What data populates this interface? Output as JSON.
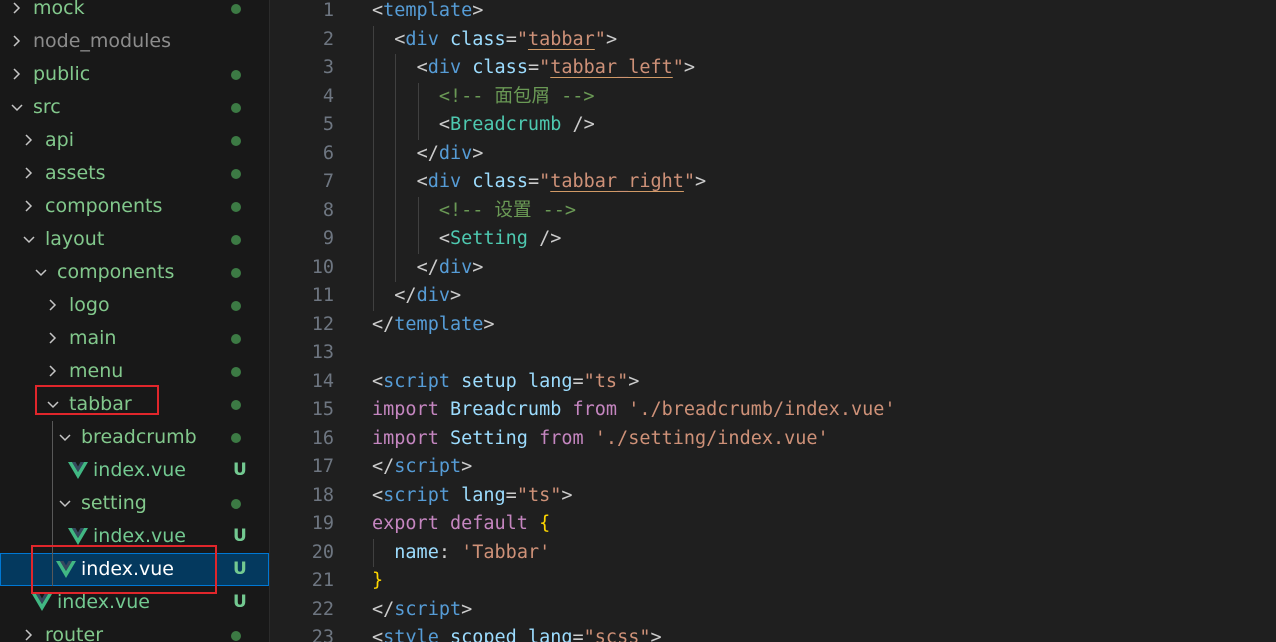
{
  "explorer": {
    "items": [
      {
        "label": "mock",
        "indent": 0,
        "kind": "folder",
        "state": "collapsed",
        "color": "#82c88c",
        "status": "dot"
      },
      {
        "label": "node_modules",
        "indent": 0,
        "kind": "folder",
        "state": "collapsed",
        "color": "#8c8c8c",
        "status": "none"
      },
      {
        "label": "public",
        "indent": 0,
        "kind": "folder",
        "state": "collapsed",
        "color": "#82c88c",
        "status": "dot"
      },
      {
        "label": "src",
        "indent": 0,
        "kind": "folder",
        "state": "expanded",
        "color": "#82c88c",
        "status": "dot"
      },
      {
        "label": "api",
        "indent": 1,
        "kind": "folder",
        "state": "collapsed",
        "color": "#82c88c",
        "status": "dot"
      },
      {
        "label": "assets",
        "indent": 1,
        "kind": "folder",
        "state": "collapsed",
        "color": "#82c88c",
        "status": "dot"
      },
      {
        "label": "components",
        "indent": 1,
        "kind": "folder",
        "state": "collapsed",
        "color": "#82c88c",
        "status": "dot"
      },
      {
        "label": "layout",
        "indent": 1,
        "kind": "folder",
        "state": "expanded",
        "color": "#82c88c",
        "status": "dot"
      },
      {
        "label": "components",
        "indent": 2,
        "kind": "folder",
        "state": "expanded",
        "color": "#82c88c",
        "status": "dot"
      },
      {
        "label": "logo",
        "indent": 3,
        "kind": "folder",
        "state": "collapsed",
        "color": "#82c88c",
        "status": "dot"
      },
      {
        "label": "main",
        "indent": 3,
        "kind": "folder",
        "state": "collapsed",
        "color": "#82c88c",
        "status": "dot"
      },
      {
        "label": "menu",
        "indent": 3,
        "kind": "folder",
        "state": "collapsed",
        "color": "#82c88c",
        "status": "dot"
      },
      {
        "label": "tabbar",
        "indent": 3,
        "kind": "folder",
        "state": "expanded",
        "color": "#82c88c",
        "status": "dot"
      },
      {
        "label": "breadcrumb",
        "indent": 4,
        "kind": "folder",
        "state": "expanded",
        "color": "#82c88c",
        "status": "dot"
      },
      {
        "label": "index.vue",
        "indent": 5,
        "kind": "vue",
        "color": "#73c991",
        "status": "U"
      },
      {
        "label": "setting",
        "indent": 4,
        "kind": "folder",
        "state": "expanded",
        "color": "#82c88c",
        "status": "dot"
      },
      {
        "label": "index.vue",
        "indent": 5,
        "kind": "vue",
        "color": "#73c991",
        "status": "U"
      },
      {
        "label": "index.vue",
        "indent": 4,
        "kind": "vue",
        "color": "#ffffff",
        "status": "U",
        "selected": true
      },
      {
        "label": "index.vue",
        "indent": 2,
        "kind": "vue",
        "color": "#73c991",
        "status": "U"
      },
      {
        "label": "router",
        "indent": 1,
        "kind": "folder",
        "state": "collapsed",
        "color": "#82c88c",
        "status": "dot"
      }
    ]
  },
  "editor": {
    "colors": {
      "tag": "#569cd6",
      "attr": "#9cdcfe",
      "string": "#ce9178",
      "comment": "#6a9955",
      "keyword": "#c586c0",
      "ident": "#dcdcaa",
      "plain": "#cccccc",
      "brace": "#ffd700",
      "component": "#4ec9b0"
    },
    "lines": [
      {
        "n": "1",
        "guides": 0,
        "tokens": [
          {
            "t": "<",
            "c": "plain"
          },
          {
            "t": "template",
            "c": "tag"
          },
          {
            "t": ">",
            "c": "plain"
          }
        ]
      },
      {
        "n": "2",
        "guides": 1,
        "tokens": [
          {
            "t": "  "
          },
          {
            "t": "<",
            "c": "plain"
          },
          {
            "t": "div",
            "c": "tag"
          },
          {
            "t": " "
          },
          {
            "t": "class",
            "c": "attr"
          },
          {
            "t": "=",
            "c": "plain"
          },
          {
            "t": "\"",
            "c": "string"
          },
          {
            "t": "tabbar",
            "c": "string",
            "u": true
          },
          {
            "t": "\"",
            "c": "string"
          },
          {
            "t": ">",
            "c": "plain"
          }
        ]
      },
      {
        "n": "3",
        "guides": 2,
        "tokens": [
          {
            "t": "    "
          },
          {
            "t": "<",
            "c": "plain"
          },
          {
            "t": "div",
            "c": "tag"
          },
          {
            "t": " "
          },
          {
            "t": "class",
            "c": "attr"
          },
          {
            "t": "=",
            "c": "plain"
          },
          {
            "t": "\"",
            "c": "string"
          },
          {
            "t": "tabbar_left",
            "c": "string",
            "u": true
          },
          {
            "t": "\"",
            "c": "string"
          },
          {
            "t": ">",
            "c": "plain"
          }
        ]
      },
      {
        "n": "4",
        "guides": 3,
        "tokens": [
          {
            "t": "      "
          },
          {
            "t": "<!-- 面包屑 -->",
            "c": "comment"
          }
        ]
      },
      {
        "n": "5",
        "guides": 3,
        "tokens": [
          {
            "t": "      "
          },
          {
            "t": "<",
            "c": "plain"
          },
          {
            "t": "Breadcrumb",
            "c": "component"
          },
          {
            "t": " />",
            "c": "plain"
          }
        ]
      },
      {
        "n": "6",
        "guides": 2,
        "tokens": [
          {
            "t": "    "
          },
          {
            "t": "</",
            "c": "plain"
          },
          {
            "t": "div",
            "c": "tag"
          },
          {
            "t": ">",
            "c": "plain"
          }
        ]
      },
      {
        "n": "7",
        "guides": 2,
        "tokens": [
          {
            "t": "    "
          },
          {
            "t": "<",
            "c": "plain"
          },
          {
            "t": "div",
            "c": "tag"
          },
          {
            "t": " "
          },
          {
            "t": "class",
            "c": "attr"
          },
          {
            "t": "=",
            "c": "plain"
          },
          {
            "t": "\"",
            "c": "string"
          },
          {
            "t": "tabbar_right",
            "c": "string",
            "u": true
          },
          {
            "t": "\"",
            "c": "string"
          },
          {
            "t": ">",
            "c": "plain"
          }
        ]
      },
      {
        "n": "8",
        "guides": 3,
        "tokens": [
          {
            "t": "      "
          },
          {
            "t": "<!-- 设置 -->",
            "c": "comment"
          }
        ]
      },
      {
        "n": "9",
        "guides": 3,
        "tokens": [
          {
            "t": "      "
          },
          {
            "t": "<",
            "c": "plain"
          },
          {
            "t": "Setting",
            "c": "component"
          },
          {
            "t": " />",
            "c": "plain"
          }
        ]
      },
      {
        "n": "10",
        "guides": 2,
        "tokens": [
          {
            "t": "    "
          },
          {
            "t": "</",
            "c": "plain"
          },
          {
            "t": "div",
            "c": "tag"
          },
          {
            "t": ">",
            "c": "plain"
          }
        ]
      },
      {
        "n": "11",
        "guides": 1,
        "tokens": [
          {
            "t": "  "
          },
          {
            "t": "</",
            "c": "plain"
          },
          {
            "t": "div",
            "c": "tag"
          },
          {
            "t": ">",
            "c": "plain"
          }
        ]
      },
      {
        "n": "12",
        "guides": 0,
        "tokens": [
          {
            "t": "</",
            "c": "plain"
          },
          {
            "t": "template",
            "c": "tag"
          },
          {
            "t": ">",
            "c": "plain"
          }
        ]
      },
      {
        "n": "13",
        "guides": 0,
        "tokens": []
      },
      {
        "n": "14",
        "guides": 0,
        "tokens": [
          {
            "t": "<",
            "c": "plain"
          },
          {
            "t": "script",
            "c": "tag"
          },
          {
            "t": " "
          },
          {
            "t": "setup",
            "c": "attr"
          },
          {
            "t": " "
          },
          {
            "t": "lang",
            "c": "attr"
          },
          {
            "t": "=",
            "c": "plain"
          },
          {
            "t": "\"ts\"",
            "c": "string"
          },
          {
            "t": ">",
            "c": "plain"
          }
        ]
      },
      {
        "n": "15",
        "guides": 0,
        "tokens": [
          {
            "t": "import",
            "c": "keyword"
          },
          {
            "t": " "
          },
          {
            "t": "Breadcrumb",
            "c": "attr"
          },
          {
            "t": " "
          },
          {
            "t": "from",
            "c": "keyword"
          },
          {
            "t": " "
          },
          {
            "t": "'./breadcrumb/index.vue'",
            "c": "string"
          }
        ]
      },
      {
        "n": "16",
        "guides": 0,
        "tokens": [
          {
            "t": "import",
            "c": "keyword"
          },
          {
            "t": " "
          },
          {
            "t": "Setting",
            "c": "attr"
          },
          {
            "t": " "
          },
          {
            "t": "from",
            "c": "keyword"
          },
          {
            "t": " "
          },
          {
            "t": "'./setting/index.vue'",
            "c": "string"
          }
        ]
      },
      {
        "n": "17",
        "guides": 0,
        "tokens": [
          {
            "t": "</",
            "c": "plain"
          },
          {
            "t": "script",
            "c": "tag"
          },
          {
            "t": ">",
            "c": "plain"
          }
        ]
      },
      {
        "n": "18",
        "guides": 0,
        "tokens": [
          {
            "t": "<",
            "c": "plain"
          },
          {
            "t": "script",
            "c": "tag"
          },
          {
            "t": " "
          },
          {
            "t": "lang",
            "c": "attr"
          },
          {
            "t": "=",
            "c": "plain"
          },
          {
            "t": "\"ts\"",
            "c": "string"
          },
          {
            "t": ">",
            "c": "plain"
          }
        ]
      },
      {
        "n": "19",
        "guides": 0,
        "tokens": [
          {
            "t": "export",
            "c": "keyword"
          },
          {
            "t": " "
          },
          {
            "t": "default",
            "c": "keyword"
          },
          {
            "t": " "
          },
          {
            "t": "{",
            "c": "brace"
          }
        ]
      },
      {
        "n": "20",
        "guides": 1,
        "tokens": [
          {
            "t": "  "
          },
          {
            "t": "name",
            "c": "attr"
          },
          {
            "t": ": ",
            "c": "plain"
          },
          {
            "t": "'Tabbar'",
            "c": "string"
          }
        ]
      },
      {
        "n": "21",
        "guides": 0,
        "tokens": [
          {
            "t": "}",
            "c": "brace"
          }
        ]
      },
      {
        "n": "22",
        "guides": 0,
        "tokens": [
          {
            "t": "</",
            "c": "plain"
          },
          {
            "t": "script",
            "c": "tag"
          },
          {
            "t": ">",
            "c": "plain"
          }
        ]
      },
      {
        "n": "23",
        "guides": 0,
        "tokens": [
          {
            "t": "<",
            "c": "plain"
          },
          {
            "t": "style",
            "c": "tag"
          },
          {
            "t": " "
          },
          {
            "t": "scoped",
            "c": "attr"
          },
          {
            "t": " "
          },
          {
            "t": "lang",
            "c": "attr"
          },
          {
            "t": "=",
            "c": "plain"
          },
          {
            "t": "\"scss\"",
            "c": "string"
          },
          {
            "t": ">",
            "c": "plain"
          }
        ]
      }
    ]
  }
}
